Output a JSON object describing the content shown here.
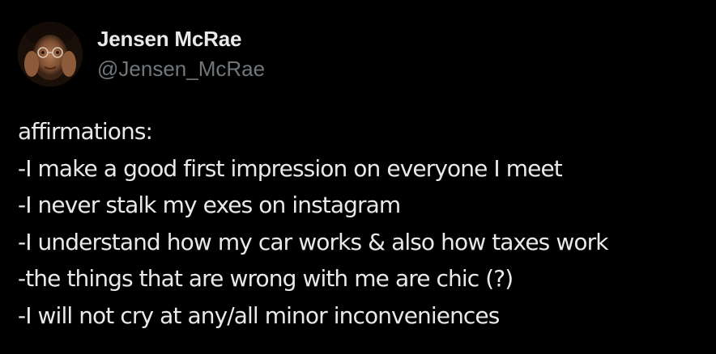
{
  "tweet": {
    "author": {
      "display_name": "Jensen McRae",
      "handle": "@Jensen_McRae",
      "avatar_icon": "profile-photo"
    },
    "lines": [
      "affirmations:",
      "-I make a good first impression on everyone I meet",
      "-I never stalk my exes on instagram",
      "-I understand how my car works & also how taxes work",
      "-the things that are wrong with me are chic (?)",
      "-I will not cry at any/all minor inconveniences"
    ]
  },
  "colors": {
    "background": "#000000",
    "primary_text": "#e7e9ea",
    "secondary_text": "#71767b"
  }
}
